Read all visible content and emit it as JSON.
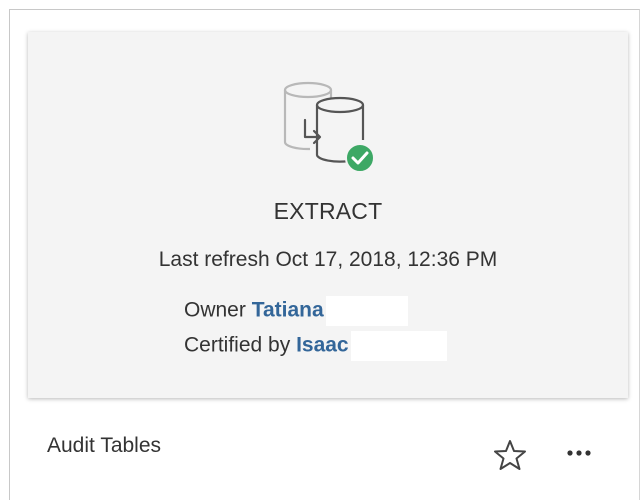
{
  "card": {
    "datasource_type": "EXTRACT",
    "last_refresh": "Last refresh Oct 17, 2018, 12:36 PM",
    "owner_label": "Owner",
    "owner_name": "Tatiana",
    "certified_label": "Certified by",
    "certifier_name": "Isaac",
    "title": "Audit Tables",
    "icon": "extract-datasource-certified-icon",
    "favorite_icon": "star-outline-icon",
    "more_icon": "more-actions-icon"
  },
  "colors": {
    "link": "#336699",
    "certified_badge": "#3da865",
    "panel_bg": "#f4f4f4",
    "text": "#333333"
  }
}
